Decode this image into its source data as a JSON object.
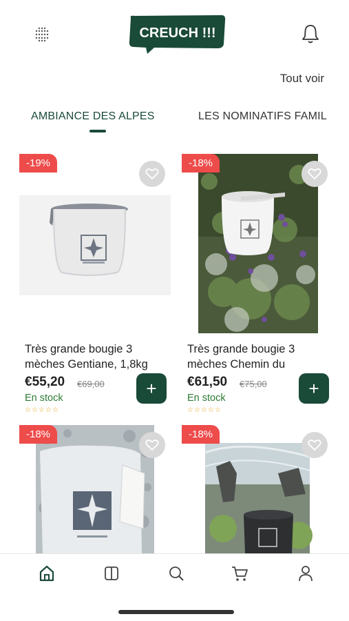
{
  "header": {
    "logo_text": "CREUCH !!!",
    "menu_icon": "grid-dots-icon",
    "notification_icon": "bell-icon"
  },
  "section": {
    "see_all_label": "Tout voir"
  },
  "tabs": [
    {
      "label": "AMBIANCE DES ALPES",
      "active": true
    },
    {
      "label": "LES NOMINATIFS FAMIL",
      "active": false
    }
  ],
  "products": [
    {
      "badge": "-19%",
      "title": "Très grande bougie 3 mèches Gentiane, 1,8kg",
      "price": "€55,20",
      "old_price": "€69,00",
      "stock": "En stock",
      "stars": "☆☆☆☆☆",
      "add_label": "+"
    },
    {
      "badge": "-18%",
      "title": "Très grande bougie 3 mèches Chemin du",
      "price": "€61,50",
      "old_price": "€75,00",
      "stock": "En stock",
      "stars": "☆☆☆☆☆",
      "add_label": "+"
    },
    {
      "badge": "-18%"
    },
    {
      "badge": "-18%"
    }
  ],
  "bottom_nav": [
    {
      "icon": "home-icon",
      "active": true
    },
    {
      "icon": "catalog-icon",
      "active": false
    },
    {
      "icon": "search-icon",
      "active": false
    },
    {
      "icon": "cart-icon",
      "active": false
    },
    {
      "icon": "account-icon",
      "active": false
    }
  ],
  "colors": {
    "brand": "#1a4a38",
    "badge": "#ee4b4b",
    "stock": "#2c7a33",
    "stars": "#e3a21a"
  }
}
